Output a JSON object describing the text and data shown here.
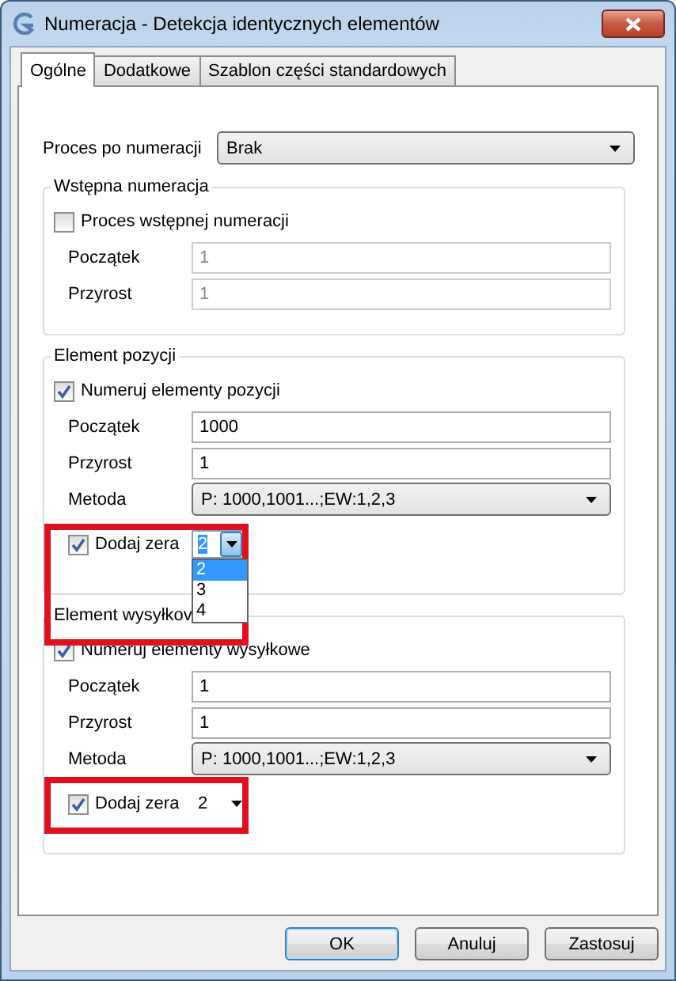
{
  "window": {
    "title": "Numeracja - Detekcja identycznych elementów"
  },
  "tabs": [
    {
      "label": "Ogólne",
      "selected": true
    },
    {
      "label": "Dodatkowe",
      "selected": false
    },
    {
      "label": "Szablon części standardowych",
      "selected": false
    }
  ],
  "process": {
    "label": "Proces po numeracji",
    "value": "Brak"
  },
  "groups": [
    {
      "legend": "Wstępna numeracja",
      "checkbox": {
        "label": "Proces wstępnej numeracji",
        "checked": false
      },
      "fields": [
        {
          "label": "Początek",
          "value": "1",
          "disabled": true
        },
        {
          "label": "Przyrost",
          "value": "1",
          "disabled": true
        }
      ]
    },
    {
      "legend": "Element pozycji",
      "checkbox": {
        "label": "Numeruj elementy pozycji",
        "checked": true
      },
      "fields": [
        {
          "label": "Początek",
          "value": "1000",
          "disabled": false
        },
        {
          "label": "Przyrost",
          "value": "1",
          "disabled": false
        }
      ],
      "method": {
        "label": "Metoda",
        "value": "P: 1000,1001...;EW:1,2,3"
      },
      "zeros": {
        "label": "Dodaj zera",
        "checked": true,
        "value": "2",
        "expanded": true,
        "highlighted": true,
        "options": [
          {
            "label": "2",
            "selected": true
          },
          {
            "label": "3",
            "selected": false
          },
          {
            "label": "4",
            "selected": false
          }
        ]
      }
    },
    {
      "legend": "Element wysyłkov",
      "checkbox": {
        "label": "Numeruj elementy wysyłkowe",
        "checked": true
      },
      "fields": [
        {
          "label": "Początek",
          "value": "1",
          "disabled": false
        },
        {
          "label": "Przyrost",
          "value": "1",
          "disabled": false
        }
      ],
      "method": {
        "label": "Metoda",
        "value": "P: 1000,1001...;EW:1,2,3"
      },
      "zeros": {
        "label": "Dodaj zera",
        "checked": true,
        "value": "2",
        "expanded": false,
        "highlighted": true
      }
    }
  ],
  "buttons": [
    {
      "label": "OK",
      "default": true
    },
    {
      "label": "Anuluj",
      "default": false
    },
    {
      "label": "Zastosuj",
      "default": false
    }
  ]
}
